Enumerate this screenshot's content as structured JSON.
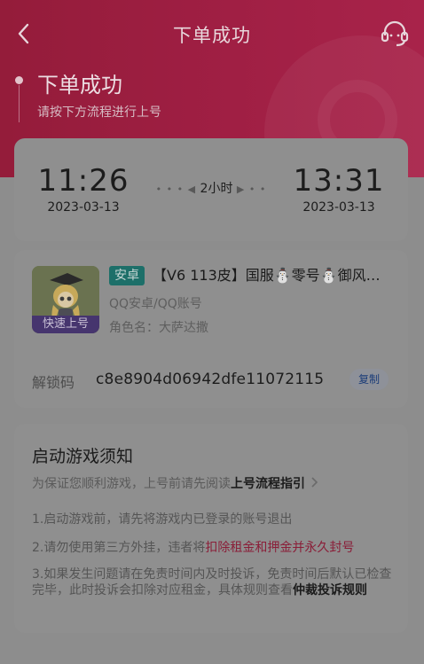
{
  "nav": {
    "title": "下单成功",
    "back_icon": "chevron-left-icon",
    "service_icon": "headset-icon"
  },
  "status": {
    "title": "下单成功",
    "subtitle": "请按下方流程进行上号"
  },
  "rental": {
    "start_time": "11:26",
    "start_date": "2023-03-13",
    "duration": "2小时",
    "end_time": "13:31",
    "end_date": "2023-03-13"
  },
  "order": {
    "thumb_badge": "快速上号",
    "platform": "安卓",
    "title": "【V6 113皮】国服⛄零号⛄御风…",
    "account_type": "QQ安卓/QQ账号",
    "role_label": "角色名：",
    "role_name": "大萨达撒",
    "unlock_label": "解锁码",
    "unlock_code": "c8e8904d06942dfe11072115",
    "copy_label": "复制"
  },
  "notice": {
    "title": "启动游戏须知",
    "subtitle_prefix": "为保证您顺利游戏，上号前请先阅读",
    "subtitle_link": "上号流程指引",
    "rule1": "1.启动游戏前，请先将游戏内已登录的账号退出",
    "rule2_prefix": "2.请勿使用第三方外挂，违者将",
    "rule2_warning": "扣除租金和押金并永久封号",
    "rule3_prefix": "3.如果发生问题请在免责时间内及时投诉，免责时间后默认已检查完毕，此时投诉会扣除对应租金，具体规则查看",
    "rule3_link": "仲裁投诉规则"
  },
  "colors": {
    "brand": "#a01f44",
    "warning_text": "#8a1e38",
    "platform_tag": "#1d6f69"
  }
}
